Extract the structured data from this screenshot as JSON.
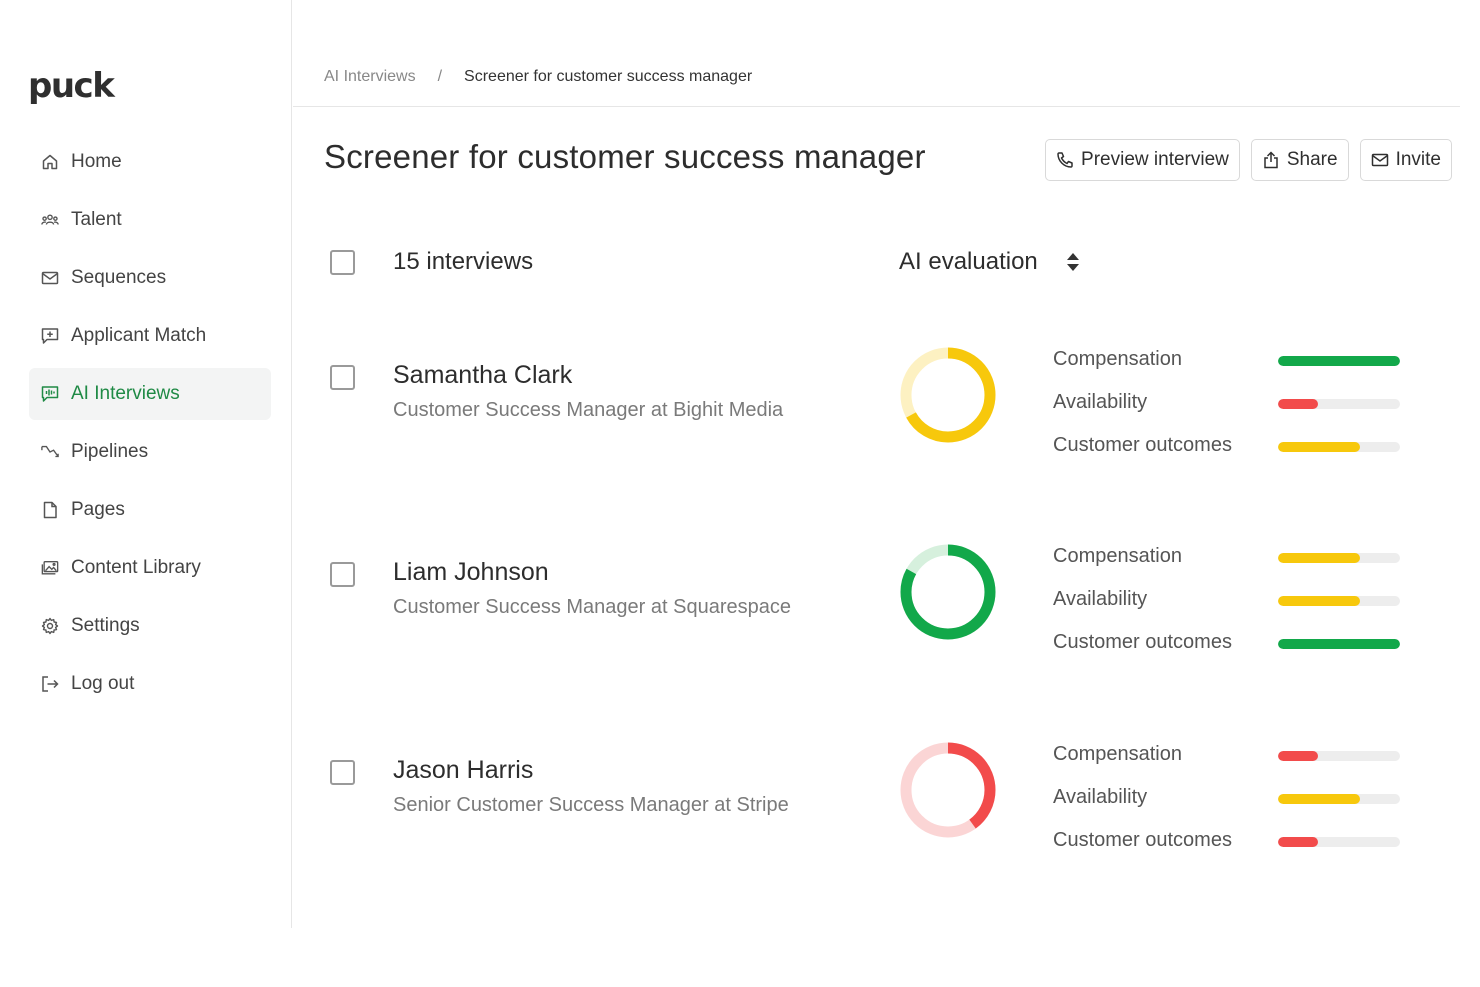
{
  "brand": {
    "name": "puck"
  },
  "colors": {
    "green": "#12a84a",
    "yellow": "#f7c80c",
    "red": "#f24b4b",
    "active_nav": "#1f8a45"
  },
  "sidebar": {
    "items": [
      {
        "label": "Home",
        "icon": "home-icon"
      },
      {
        "label": "Talent",
        "icon": "people-icon"
      },
      {
        "label": "Sequences",
        "icon": "mail-icon"
      },
      {
        "label": "Applicant Match",
        "icon": "chat-plus-icon"
      },
      {
        "label": "AI Interviews",
        "icon": "waveform-chat-icon",
        "active": true
      },
      {
        "label": "Pipelines",
        "icon": "pipeline-icon"
      },
      {
        "label": "Pages",
        "icon": "page-icon"
      },
      {
        "label": "Content Library",
        "icon": "image-library-icon"
      },
      {
        "label": "Settings",
        "icon": "gear-icon"
      },
      {
        "label": "Log out",
        "icon": "logout-icon"
      }
    ]
  },
  "breadcrumb": {
    "parent": "AI Interviews",
    "separator": "/",
    "current": "Screener for customer success manager"
  },
  "page": {
    "title": "Screener for customer success manager",
    "actions": {
      "preview": "Preview interview",
      "share": "Share",
      "invite": "Invite"
    }
  },
  "list": {
    "count_label": "15 interviews",
    "evaluation_label": "AI evaluation",
    "candidates": [
      {
        "name": "Samantha Clark",
        "role": "Customer Success Manager at Bighit Media",
        "score": 0.67,
        "score_color": "yellow",
        "metrics": [
          {
            "label": "Compensation",
            "value": 1.0,
            "color": "green"
          },
          {
            "label": "Availability",
            "value": 0.33,
            "color": "red"
          },
          {
            "label": "Customer outcomes",
            "value": 0.67,
            "color": "yellow"
          }
        ]
      },
      {
        "name": "Liam Johnson",
        "role": "Customer Success Manager at Squarespace",
        "score": 0.83,
        "score_color": "green",
        "metrics": [
          {
            "label": "Compensation",
            "value": 0.67,
            "color": "yellow"
          },
          {
            "label": "Availability",
            "value": 0.67,
            "color": "yellow"
          },
          {
            "label": "Customer outcomes",
            "value": 1.0,
            "color": "green"
          }
        ]
      },
      {
        "name": "Jason Harris",
        "role": "Senior Customer Success Manager at Stripe",
        "score": 0.4,
        "score_color": "red",
        "metrics": [
          {
            "label": "Compensation",
            "value": 0.33,
            "color": "red"
          },
          {
            "label": "Availability",
            "value": 0.67,
            "color": "yellow"
          },
          {
            "label": "Customer outcomes",
            "value": 0.33,
            "color": "red"
          }
        ]
      }
    ]
  }
}
